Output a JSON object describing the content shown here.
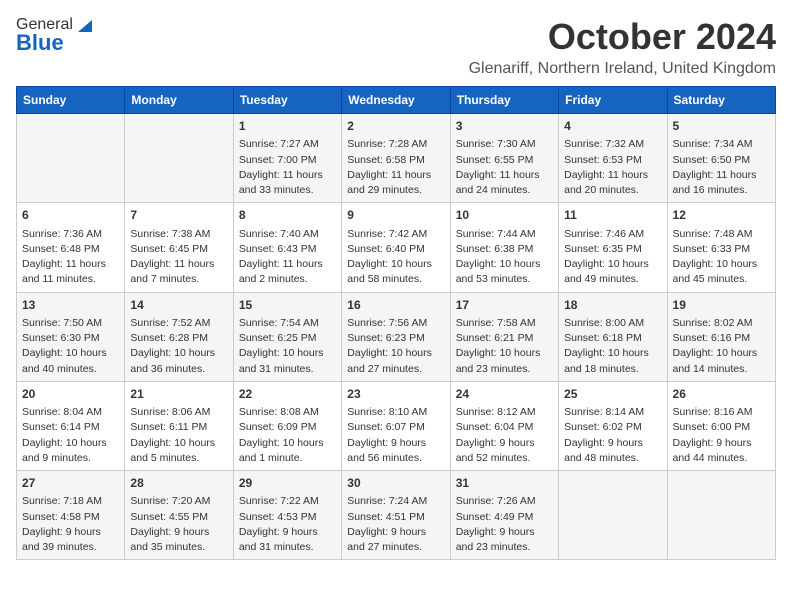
{
  "logo": {
    "general": "General",
    "blue": "Blue"
  },
  "header": {
    "month": "October 2024",
    "location": "Glenariff, Northern Ireland, United Kingdom"
  },
  "days_of_week": [
    "Sunday",
    "Monday",
    "Tuesday",
    "Wednesday",
    "Thursday",
    "Friday",
    "Saturday"
  ],
  "weeks": [
    [
      {
        "day": "",
        "info": ""
      },
      {
        "day": "",
        "info": ""
      },
      {
        "day": "1",
        "info": "Sunrise: 7:27 AM\nSunset: 7:00 PM\nDaylight: 11 hours\nand 33 minutes."
      },
      {
        "day": "2",
        "info": "Sunrise: 7:28 AM\nSunset: 6:58 PM\nDaylight: 11 hours\nand 29 minutes."
      },
      {
        "day": "3",
        "info": "Sunrise: 7:30 AM\nSunset: 6:55 PM\nDaylight: 11 hours\nand 24 minutes."
      },
      {
        "day": "4",
        "info": "Sunrise: 7:32 AM\nSunset: 6:53 PM\nDaylight: 11 hours\nand 20 minutes."
      },
      {
        "day": "5",
        "info": "Sunrise: 7:34 AM\nSunset: 6:50 PM\nDaylight: 11 hours\nand 16 minutes."
      }
    ],
    [
      {
        "day": "6",
        "info": "Sunrise: 7:36 AM\nSunset: 6:48 PM\nDaylight: 11 hours\nand 11 minutes."
      },
      {
        "day": "7",
        "info": "Sunrise: 7:38 AM\nSunset: 6:45 PM\nDaylight: 11 hours\nand 7 minutes."
      },
      {
        "day": "8",
        "info": "Sunrise: 7:40 AM\nSunset: 6:43 PM\nDaylight: 11 hours\nand 2 minutes."
      },
      {
        "day": "9",
        "info": "Sunrise: 7:42 AM\nSunset: 6:40 PM\nDaylight: 10 hours\nand 58 minutes."
      },
      {
        "day": "10",
        "info": "Sunrise: 7:44 AM\nSunset: 6:38 PM\nDaylight: 10 hours\nand 53 minutes."
      },
      {
        "day": "11",
        "info": "Sunrise: 7:46 AM\nSunset: 6:35 PM\nDaylight: 10 hours\nand 49 minutes."
      },
      {
        "day": "12",
        "info": "Sunrise: 7:48 AM\nSunset: 6:33 PM\nDaylight: 10 hours\nand 45 minutes."
      }
    ],
    [
      {
        "day": "13",
        "info": "Sunrise: 7:50 AM\nSunset: 6:30 PM\nDaylight: 10 hours\nand 40 minutes."
      },
      {
        "day": "14",
        "info": "Sunrise: 7:52 AM\nSunset: 6:28 PM\nDaylight: 10 hours\nand 36 minutes."
      },
      {
        "day": "15",
        "info": "Sunrise: 7:54 AM\nSunset: 6:25 PM\nDaylight: 10 hours\nand 31 minutes."
      },
      {
        "day": "16",
        "info": "Sunrise: 7:56 AM\nSunset: 6:23 PM\nDaylight: 10 hours\nand 27 minutes."
      },
      {
        "day": "17",
        "info": "Sunrise: 7:58 AM\nSunset: 6:21 PM\nDaylight: 10 hours\nand 23 minutes."
      },
      {
        "day": "18",
        "info": "Sunrise: 8:00 AM\nSunset: 6:18 PM\nDaylight: 10 hours\nand 18 minutes."
      },
      {
        "day": "19",
        "info": "Sunrise: 8:02 AM\nSunset: 6:16 PM\nDaylight: 10 hours\nand 14 minutes."
      }
    ],
    [
      {
        "day": "20",
        "info": "Sunrise: 8:04 AM\nSunset: 6:14 PM\nDaylight: 10 hours\nand 9 minutes."
      },
      {
        "day": "21",
        "info": "Sunrise: 8:06 AM\nSunset: 6:11 PM\nDaylight: 10 hours\nand 5 minutes."
      },
      {
        "day": "22",
        "info": "Sunrise: 8:08 AM\nSunset: 6:09 PM\nDaylight: 10 hours\nand 1 minute."
      },
      {
        "day": "23",
        "info": "Sunrise: 8:10 AM\nSunset: 6:07 PM\nDaylight: 9 hours\nand 56 minutes."
      },
      {
        "day": "24",
        "info": "Sunrise: 8:12 AM\nSunset: 6:04 PM\nDaylight: 9 hours\nand 52 minutes."
      },
      {
        "day": "25",
        "info": "Sunrise: 8:14 AM\nSunset: 6:02 PM\nDaylight: 9 hours\nand 48 minutes."
      },
      {
        "day": "26",
        "info": "Sunrise: 8:16 AM\nSunset: 6:00 PM\nDaylight: 9 hours\nand 44 minutes."
      }
    ],
    [
      {
        "day": "27",
        "info": "Sunrise: 7:18 AM\nSunset: 4:58 PM\nDaylight: 9 hours\nand 39 minutes."
      },
      {
        "day": "28",
        "info": "Sunrise: 7:20 AM\nSunset: 4:55 PM\nDaylight: 9 hours\nand 35 minutes."
      },
      {
        "day": "29",
        "info": "Sunrise: 7:22 AM\nSunset: 4:53 PM\nDaylight: 9 hours\nand 31 minutes."
      },
      {
        "day": "30",
        "info": "Sunrise: 7:24 AM\nSunset: 4:51 PM\nDaylight: 9 hours\nand 27 minutes."
      },
      {
        "day": "31",
        "info": "Sunrise: 7:26 AM\nSunset: 4:49 PM\nDaylight: 9 hours\nand 23 minutes."
      },
      {
        "day": "",
        "info": ""
      },
      {
        "day": "",
        "info": ""
      }
    ]
  ]
}
